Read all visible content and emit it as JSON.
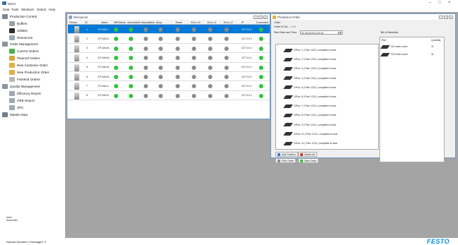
{
  "window": {
    "title": "MES4"
  },
  "menu": [
    "Data",
    "Tools",
    "Windows",
    "Orders",
    "Help"
  ],
  "sidebar": {
    "items": [
      {
        "label": "Production Control",
        "icon": "production-icon",
        "level": 0
      },
      {
        "label": "Buffers",
        "icon": "buffers-icon",
        "level": 1
      },
      {
        "label": "Utilities",
        "icon": "utilities-icon",
        "level": 1
      },
      {
        "label": "Resources",
        "icon": "resources-icon",
        "level": 1
      },
      {
        "label": "Order Management",
        "icon": "order-management-icon",
        "level": 0
      },
      {
        "label": "Current Orders",
        "icon": "current-orders-icon",
        "level": 1
      },
      {
        "label": "Planned Orders",
        "icon": "planned-orders-icon",
        "level": 1
      },
      {
        "label": "New Customer Order",
        "icon": "new-customer-order-icon",
        "level": 1
      },
      {
        "label": "New Production Order",
        "icon": "new-production-order-icon",
        "level": 1
      },
      {
        "label": "Finished Orders",
        "icon": "finished-orders-icon",
        "level": 1
      },
      {
        "label": "Quality Management",
        "icon": "quality-management-icon",
        "level": 0
      },
      {
        "label": "Efficency Report",
        "icon": "report-icon",
        "level": 1
      },
      {
        "label": "OEE Report",
        "icon": "report-icon",
        "level": 1
      },
      {
        "label": "SPC",
        "icon": "report-icon",
        "level": 1
      },
      {
        "label": "Master Data",
        "icon": "master-data-icon",
        "level": 0
      }
    ],
    "user_label_1": "Main",
    "user_label_2": "Automatic"
  },
  "resources_window": {
    "title": "Resources",
    "columns": [
      "Picture",
      "ID",
      "Name",
      "MESMode",
      "AutomaticM...",
      "ManualMod...",
      "Busy",
      "Reset",
      "Error L0",
      "Error L1",
      "Error L2",
      "IP",
      "Connected"
    ],
    "rows": [
      {
        "id": "1",
        "name": "CP-AM-T...",
        "ip": "127.0.0.1",
        "selected": true
      },
      {
        "id": "2",
        "name": "CP-AM-D...",
        "ip": "127.0.0.1",
        "selected": false
      },
      {
        "id": "3",
        "name": "CP-AM-M...",
        "ip": "127.0.0.1",
        "selected": false
      },
      {
        "id": "4",
        "name": "CP-AM-M...",
        "ip": "127.0.0.1",
        "selected": false
      },
      {
        "id": "5",
        "name": "CP-AM-M...",
        "ip": "127.0.0.1",
        "selected": false
      },
      {
        "id": "6",
        "name": "CP-AM-M...",
        "ip": "127.0.0.1",
        "selected": false
      },
      {
        "id": "7",
        "name": "CP-AM-C...",
        "ip": "127.0.0.1",
        "selected": false
      },
      {
        "id": "8",
        "name": "CP-AM-H...",
        "ip": "127.0.0.1",
        "selected": false
      }
    ],
    "colors": {
      "green": "#2ec43a",
      "grey": "#8c8c8c",
      "selected": "#0078d7"
    }
  },
  "production_window": {
    "title": "Production Order",
    "order_heading": "Order",
    "order_no_label": "Order ID No.:",
    "order_no_value": "1455",
    "start_label": "Start Date and Time:",
    "start_value": "21.03.2019 11:42:20",
    "tree_items": [
      "OPos: 1 | Part: 1211 | complete to fuse",
      "OPos: 2 | Part: 1211 | complete to fuse",
      "OPos: 3 | Part: 1211 | complete to fuse",
      "OPos: 4 | Part: 1211 | complete to fuse",
      "OPos: 5 | Part: 1211 | complete to fuse",
      "OPos: 6 | Part: 1211 | complete to fuse",
      "OPos: 7 | Part: 1211 | complete to fuse",
      "OPos: 8 | Part: 1211 | complete to fuse",
      "OPos: 9 | Part: 1211 | complete to fuse",
      "OPos: 10 | Part: 1211 | complete to fuse",
      "OPos: 11 | Part: 1211 | complete to fuse"
    ],
    "bom_title": "Bill of Materials",
    "bom_columns": [
      "Part",
      "Quantity"
    ],
    "bom_rows": [
      {
        "part": "111 back cover",
        "qty": "11"
      },
      {
        "part": "210 front cover",
        "qty": "11"
      }
    ],
    "buttons": {
      "add": "Add Position",
      "delete": "Delete All",
      "plan": "Plan Order",
      "start": "Start Order"
    }
  },
  "status": {
    "text": "Special Operator   | Messages: 0",
    "brand": "FESTO"
  }
}
